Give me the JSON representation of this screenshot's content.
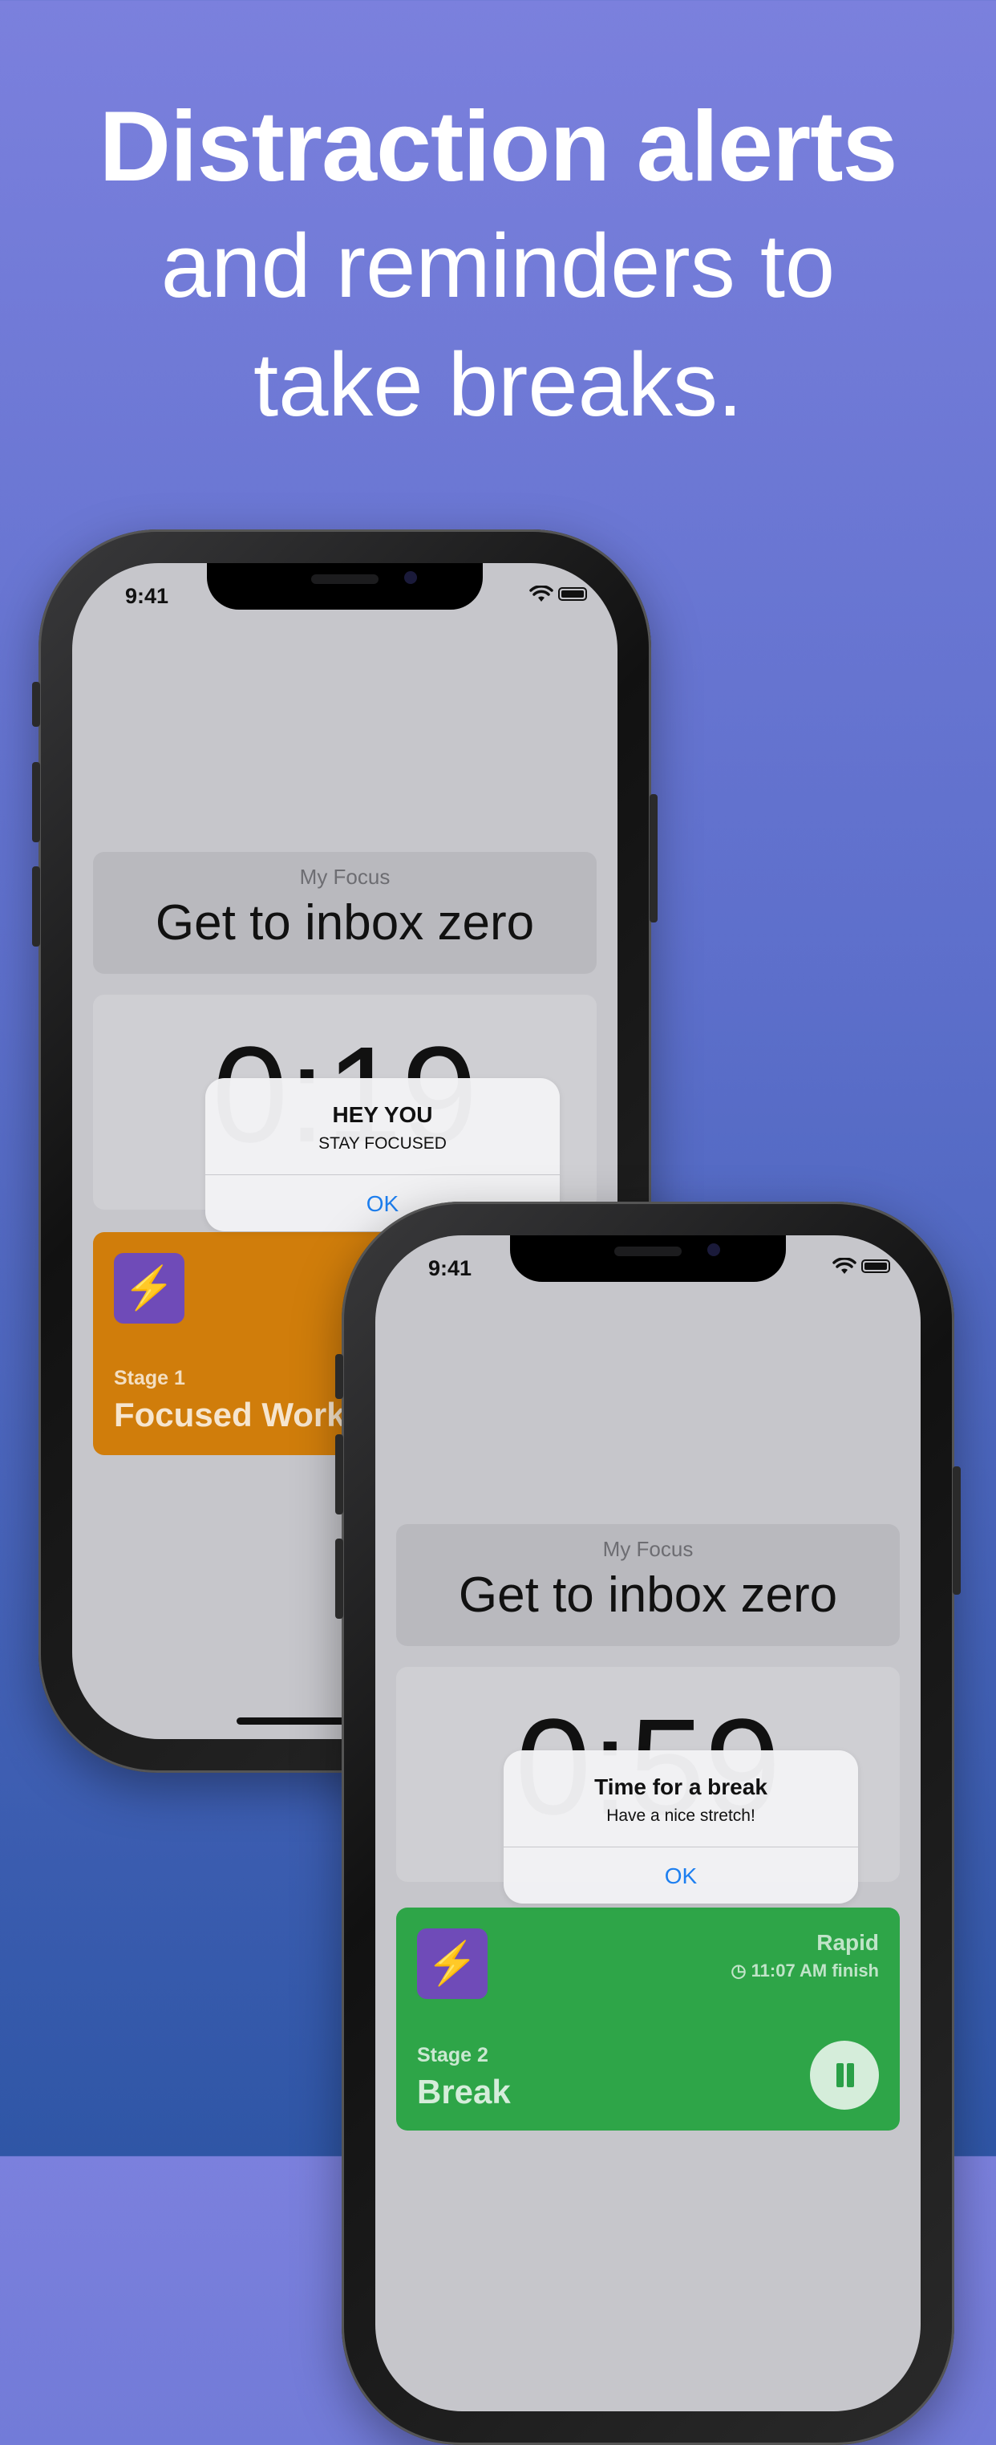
{
  "headline": {
    "line1": "Distraction alerts",
    "line2": "and reminders to",
    "line3": "take breaks."
  },
  "phone1": {
    "status_time": "9:41",
    "focus_label": "My Focus",
    "focus_goal": "Get to inbox zero",
    "timer_text": "0:19",
    "alert": {
      "title": "HEY YOU",
      "message": "STAY FOCUSED",
      "button": "OK"
    },
    "stage": {
      "label": "Stage 1",
      "name": "Focused Work",
      "color": "#d07d0b",
      "icon": "lightning-bolt-icon"
    }
  },
  "phone2": {
    "status_time": "9:41",
    "focus_label": "My Focus",
    "focus_goal": "Get to inbox zero",
    "timer_text": "0:59",
    "alert": {
      "title": "Time for a break",
      "message": "Have a nice stretch!",
      "button": "OK"
    },
    "stage": {
      "label": "Stage 2",
      "name": "Break",
      "mode": "Rapid",
      "finish": "11:07 AM finish",
      "color": "#2ea548",
      "icon": "lightning-bolt-icon"
    }
  },
  "colors": {
    "accent_blue": "#1d7ff0",
    "background_top": "#7b80dd",
    "background_bottom": "#2f56a6"
  }
}
